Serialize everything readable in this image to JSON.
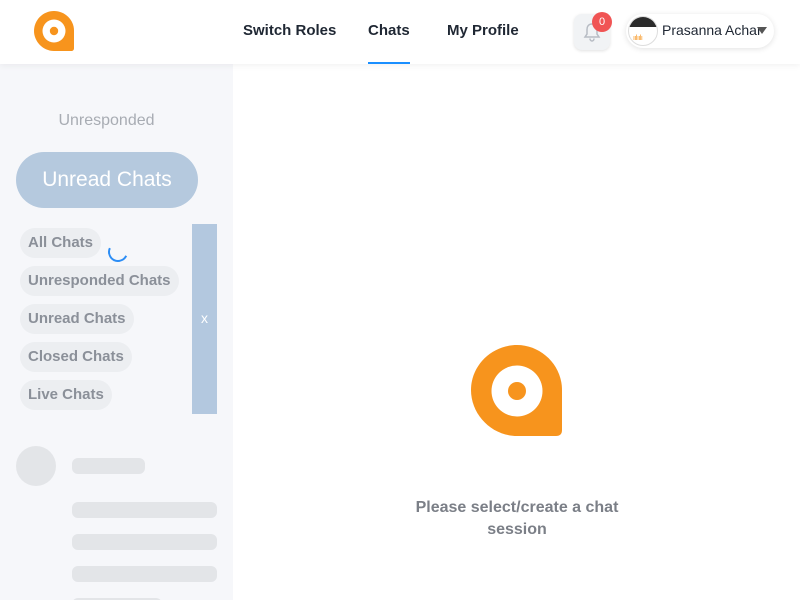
{
  "brand": {
    "logo_icon": "chat-bubble-a-logo",
    "accent": "#f7941d"
  },
  "nav": {
    "items": [
      {
        "label": "Switch Roles",
        "active": false
      },
      {
        "label": "Chats",
        "active": true
      },
      {
        "label": "My Profile",
        "active": false
      }
    ],
    "active_color": "#1a8fff"
  },
  "notifications": {
    "icon": "bell-icon",
    "count": "0"
  },
  "user": {
    "name": "Prasanna Achar",
    "avatar_icon": "avatar"
  },
  "sidebar": {
    "section_label": "Unresponded",
    "primary_button": "Unread Chats",
    "filters": [
      "All Chats",
      "Unresponded Chats",
      "Unread Chats",
      "Closed Chats",
      "Live Chats"
    ],
    "close_label": "x"
  },
  "main": {
    "empty_message": "Please select/create a chat session"
  }
}
